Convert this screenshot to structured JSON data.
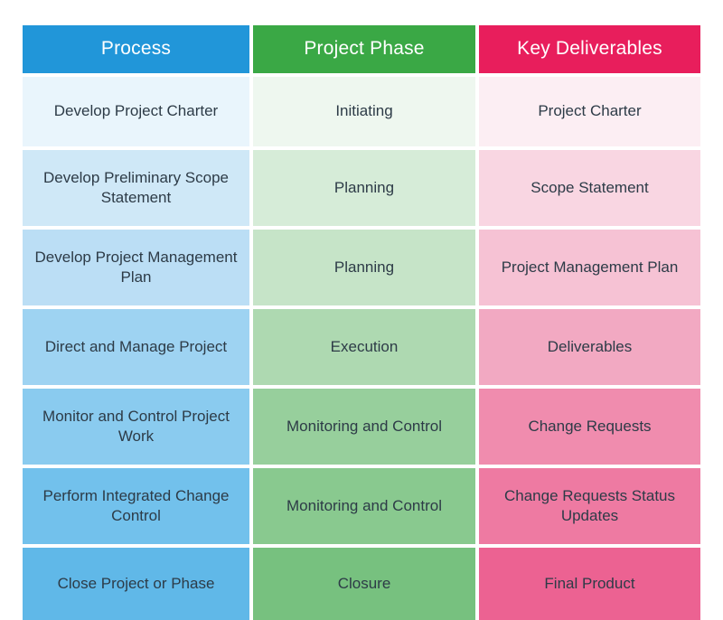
{
  "table": {
    "headers": [
      {
        "label": "Process",
        "color": "#2196d9"
      },
      {
        "label": "Project Phase",
        "color": "#3aa845"
      },
      {
        "label": "Key Deliverables",
        "color": "#e81e5c"
      }
    ],
    "rows": [
      {
        "process": "Develop Project Charter",
        "phase": "Initiating",
        "deliverable": "Project Charter"
      },
      {
        "process": "Develop Preliminary Scope Statement",
        "phase": "Planning",
        "deliverable": "Scope Statement"
      },
      {
        "process": "Develop Project Management Plan",
        "phase": "Planning",
        "deliverable": "Project Management Plan"
      },
      {
        "process": "Direct and Manage Project",
        "phase": "Execution",
        "deliverable": "Deliverables"
      },
      {
        "process": "Monitor and Control Project Work",
        "phase": "Monitoring and Control",
        "deliverable": "Change Requests"
      },
      {
        "process": "Perform Integrated Change Control",
        "phase": "Monitoring and Control",
        "deliverable": "Change Requests Status Updates"
      },
      {
        "process": "Close Project or Phase",
        "phase": "Closure",
        "deliverable": "Final Product"
      }
    ]
  }
}
